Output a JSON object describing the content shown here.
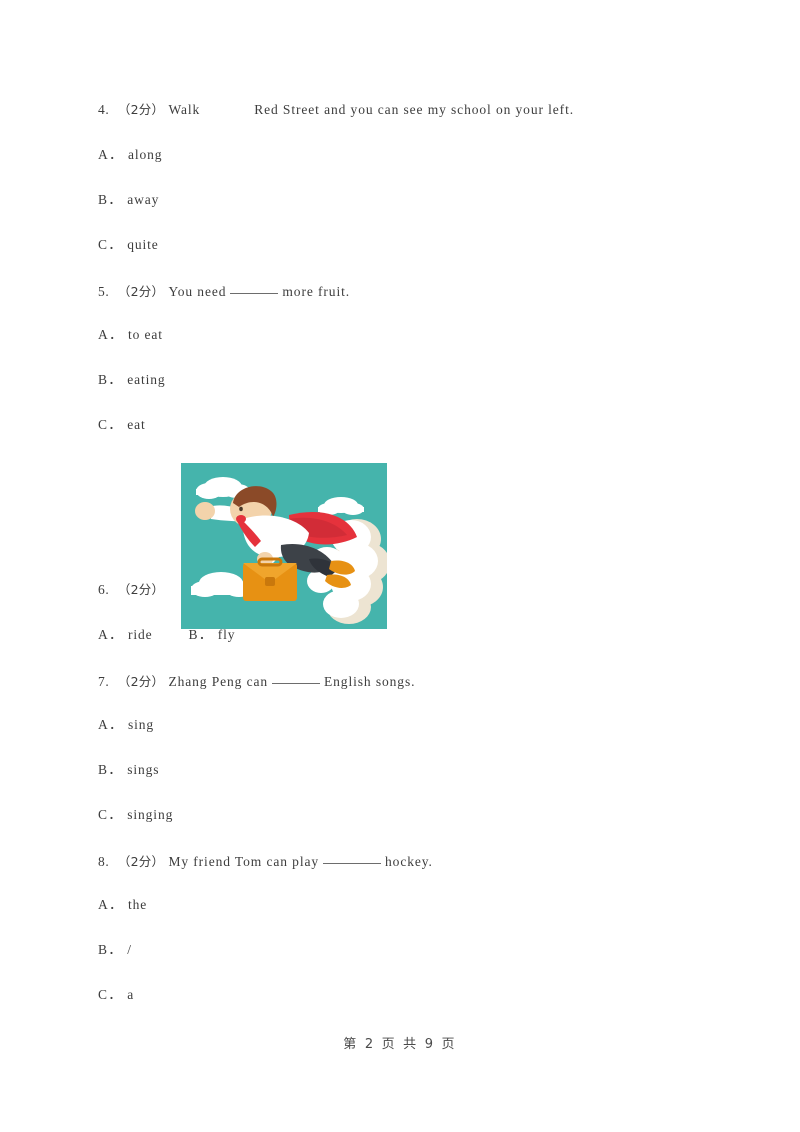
{
  "document": {
    "footer": "第 2 页 共 9 页",
    "page_number": "2",
    "total_pages": "9"
  },
  "questions": [
    {
      "number": "4.",
      "score": "（2分）",
      "text_before": "Walk",
      "blank": "gap",
      "text_after": "Red Street and you can see my school on your left.",
      "options": [
        {
          "label": "A．",
          "text": "along"
        },
        {
          "label": "B．",
          "text": "away"
        },
        {
          "label": "C．",
          "text": "quite"
        }
      ]
    },
    {
      "number": "5.",
      "score": "（2分）",
      "text_before": "You need",
      "blank": "rule",
      "text_after": "more fruit.",
      "options": [
        {
          "label": "A．",
          "text": "to eat"
        },
        {
          "label": "B．",
          "text": "eating"
        },
        {
          "label": "C．",
          "text": "eat"
        }
      ]
    },
    {
      "number": "6.",
      "score": "（2分）",
      "text_before": "",
      "blank": "none",
      "text_after": "",
      "has_image": true,
      "image_alt": "flying superhero businessman with red cape and briefcase",
      "options": [
        {
          "label": "A．",
          "text": "ride"
        },
        {
          "label": "B．",
          "text": "fly"
        }
      ]
    },
    {
      "number": "7.",
      "score": "（2分）",
      "text_before": "Zhang Peng can",
      "blank": "rule",
      "text_after": "English songs.",
      "options": [
        {
          "label": "A．",
          "text": "sing"
        },
        {
          "label": "B．",
          "text": "sings"
        },
        {
          "label": "C．",
          "text": "singing"
        }
      ]
    },
    {
      "number": "8.",
      "score": "（2分）",
      "text_before": "My friend Tom can play",
      "blank": "rule-wide",
      "text_after": "hockey.",
      "options": [
        {
          "label": "A．",
          "text": "the"
        },
        {
          "label": "B．",
          "text": "/"
        },
        {
          "label": "C．",
          "text": "a"
        }
      ]
    }
  ],
  "illustration": {
    "colors": {
      "background": "#45b4ac",
      "cloud": "#ffffff",
      "cloud_shade": "#ede4d2",
      "cape": "#e5323c",
      "cape_shade": "#c22833",
      "hair": "#8b4a28",
      "skin": "#f3d3ab",
      "shirt": "#ffffff",
      "trousers": "#3d4248",
      "briefcase": "#e79113",
      "briefcase_dark": "#c9780c",
      "shoe": "#e79113"
    }
  }
}
